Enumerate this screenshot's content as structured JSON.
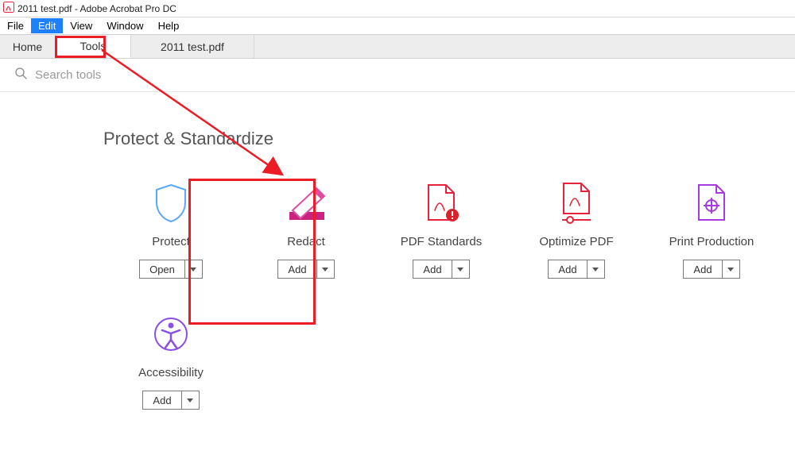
{
  "window": {
    "title": "2011 test.pdf - Adobe Acrobat Pro DC"
  },
  "menu": {
    "file": "File",
    "edit": "Edit",
    "view": "View",
    "window": "Window",
    "help": "Help"
  },
  "tabs": {
    "home": "Home",
    "tools": "Tools",
    "document": "2011 test.pdf"
  },
  "search": {
    "placeholder": "Search tools"
  },
  "section": {
    "title": "Protect & Standardize"
  },
  "buttons": {
    "open": "Open",
    "add": "Add"
  },
  "tools": {
    "protect": {
      "label": "Protect",
      "btn": "Open"
    },
    "redact": {
      "label": "Redact",
      "btn": "Add"
    },
    "pdfstandards": {
      "label": "PDF Standards",
      "btn": "Add"
    },
    "optimize": {
      "label": "Optimize PDF",
      "btn": "Add"
    },
    "printprod": {
      "label": "Print Production",
      "btn": "Add"
    },
    "accessibility": {
      "label": "Accessibility",
      "btn": "Add"
    }
  },
  "annotations": {
    "highlight_tools_tab": true,
    "highlight_redact_tool": true,
    "arrow_from_tools_to_redact": true
  }
}
